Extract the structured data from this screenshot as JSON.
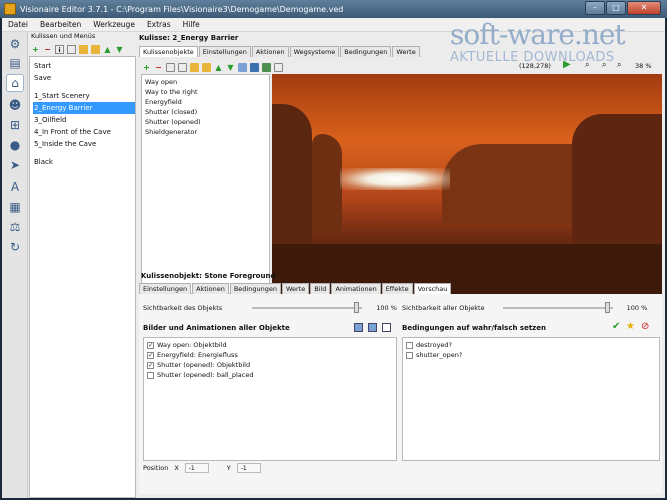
{
  "window": {
    "title": "Visionaire Editor 3.7.1 - C:\\Program Files\\Visionaire3\\Demogame\\Demogame.ved"
  },
  "menu": [
    "Datei",
    "Bearbeiten",
    "Werkzeuge",
    "Extras",
    "Hilfe"
  ],
  "scenes": {
    "header": "Kulissen und Menüs",
    "items": [
      "Start",
      "Save",
      "1_Start Scenery",
      "2_Energy Barrier",
      "3_Oilfield",
      "4_In Front of the Cave",
      "5_Inside the Cave",
      "Black"
    ],
    "selected": "2_Energy Barrier"
  },
  "kulisse": {
    "title": "Kulisse: 2_Energy Barrier",
    "tabs": [
      "Kulissenobjekte",
      "Einstellungen",
      "Aktionen",
      "Wegsysteme",
      "Bedingungen",
      "Werte"
    ],
    "active_tab": "Kulissenobjekte",
    "objects": [
      "Way open",
      "Way to the right",
      "Energyfield",
      "Shutter (closed)",
      "Shutter (opened)",
      "Shieldgenerator"
    ],
    "coords": "(128,278)",
    "zoom": "38 %"
  },
  "scene_object": {
    "title": "Kulissenobjekt: Stone Foreground",
    "tabs": [
      "Einstellungen",
      "Aktionen",
      "Bedingungen",
      "Werte",
      "Bild",
      "Animationen",
      "Effekte",
      "Vorschau"
    ],
    "active_tab": "Vorschau",
    "vis_objects_label": "Sichtbarkeit des Objekts",
    "vis_objects_value": "100 %",
    "vis_all_label": "Sichtbarkeit aller Objekte",
    "vis_all_value": "100 %",
    "images_title": "Bilder und Animationen aller Objekte",
    "images": [
      {
        "label": "Way open: Objektbild",
        "checked": true
      },
      {
        "label": "Energyfield: Energiefluss",
        "checked": true
      },
      {
        "label": "Shutter (opened): Objektbild",
        "checked": true
      },
      {
        "label": "Shutter (opened): ball_placed",
        "checked": false
      }
    ],
    "conditions_title": "Bedingungen auf wahr/falsch setzen",
    "conditions": [
      {
        "label": "destroyed?",
        "checked": false
      },
      {
        "label": "shutter_open?",
        "checked": false
      }
    ],
    "position_label": "Position",
    "x_label": "X",
    "x_value": "-1",
    "y_label": "Y",
    "y_value": "-1"
  },
  "watermark": {
    "brand": "soft-ware.net",
    "tagline": "AKTUELLE DOWNLOADS"
  },
  "colors": {
    "selection": "#3399ff",
    "accent": "#3d5a76"
  }
}
